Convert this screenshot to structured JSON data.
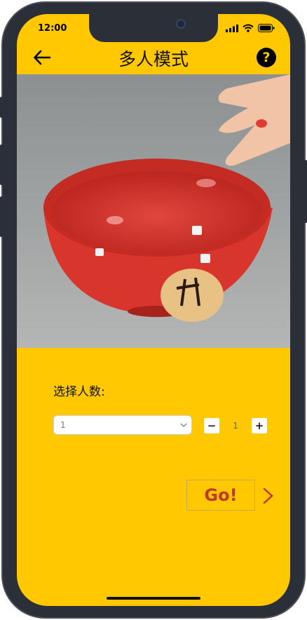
{
  "status_bar": {
    "time": "12:00"
  },
  "header": {
    "title": "多人模式",
    "help_glyph": "?"
  },
  "form": {
    "players_label": "选择人数:",
    "select_value": "1",
    "minus": "−",
    "quantity": "1",
    "plus": "+"
  },
  "go_label": "Go!",
  "colors": {
    "background": "#ffc800",
    "accent": "#c0392b",
    "bowl": "#d9322a"
  },
  "icons": [
    "back-arrow-icon",
    "help-icon",
    "chevron-down-icon",
    "chevron-right-icon",
    "signal-icon",
    "wifi-icon",
    "battery-icon"
  ]
}
